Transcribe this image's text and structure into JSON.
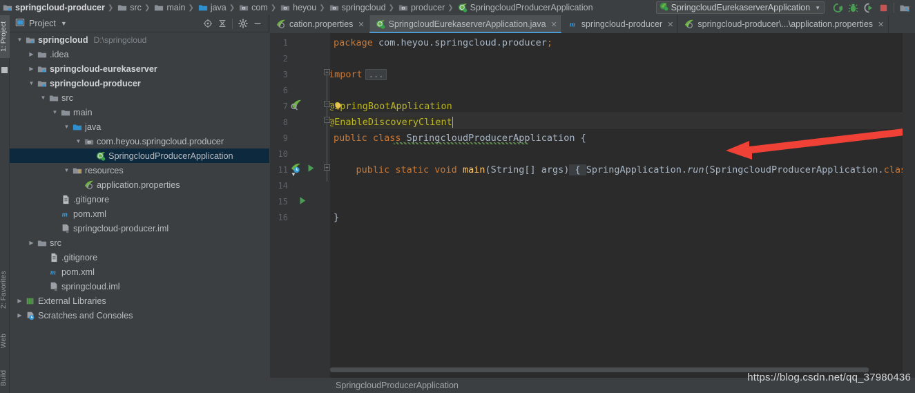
{
  "navbar": {
    "breadcrumbs": [
      {
        "label": "springcloud-producer",
        "icon": "module-icon",
        "bold": true
      },
      {
        "label": "src",
        "icon": "folder-icon",
        "bold": false
      },
      {
        "label": "main",
        "icon": "folder-icon",
        "bold": false
      },
      {
        "label": "java",
        "icon": "source-folder-icon",
        "bold": false
      },
      {
        "label": "com",
        "icon": "package-icon",
        "bold": false
      },
      {
        "label": "heyou",
        "icon": "package-icon",
        "bold": false
      },
      {
        "label": "springcloud",
        "icon": "package-icon",
        "bold": false
      },
      {
        "label": "producer",
        "icon": "package-icon",
        "bold": false
      },
      {
        "label": "SpringcloudProducerApplication",
        "icon": "spring-class-icon",
        "bold": false
      }
    ],
    "run_config": "SpringcloudEurekaserverApplication",
    "actions": [
      "run-icon",
      "debug-icon",
      "run-with-coverage-icon",
      "stop-icon",
      "project-structure-icon"
    ]
  },
  "left_stripe": {
    "tabs": [
      {
        "label": "1: Project",
        "active": true
      },
      {
        "label": "2: Favorites",
        "active": false
      },
      {
        "label": "Web",
        "active": false
      },
      {
        "label": "Build",
        "active": false
      }
    ]
  },
  "project_panel": {
    "title": "Project",
    "actions": [
      "locate-icon",
      "collapse-all-icon",
      "settings-gear-icon",
      "hide-icon"
    ],
    "tree": [
      {
        "label": "springcloud",
        "sub": "D:\\springcloud",
        "depth": 0,
        "arrow": "down",
        "icon": "module-icon",
        "bold": true,
        "selected": false
      },
      {
        "label": ".idea",
        "sub": "",
        "depth": 1,
        "arrow": "right",
        "icon": "folder-icon",
        "bold": false,
        "selected": false
      },
      {
        "label": "springcloud-eurekaserver",
        "sub": "",
        "depth": 1,
        "arrow": "right",
        "icon": "module-icon",
        "bold": true,
        "selected": false
      },
      {
        "label": "springcloud-producer",
        "sub": "",
        "depth": 1,
        "arrow": "down",
        "icon": "module-icon",
        "bold": true,
        "selected": false
      },
      {
        "label": "src",
        "sub": "",
        "depth": 2,
        "arrow": "down",
        "icon": "folder-icon",
        "bold": false,
        "selected": false
      },
      {
        "label": "main",
        "sub": "",
        "depth": 3,
        "arrow": "down",
        "icon": "folder-icon",
        "bold": false,
        "selected": false
      },
      {
        "label": "java",
        "sub": "",
        "depth": 4,
        "arrow": "down",
        "icon": "source-folder-icon",
        "bold": false,
        "selected": false
      },
      {
        "label": "com.heyou.springcloud.producer",
        "sub": "",
        "depth": 5,
        "arrow": "down",
        "icon": "package-icon",
        "bold": false,
        "selected": false
      },
      {
        "label": "SpringcloudProducerApplication",
        "sub": "",
        "depth": 6,
        "arrow": "none",
        "icon": "spring-class-icon",
        "bold": false,
        "selected": true
      },
      {
        "label": "resources",
        "sub": "",
        "depth": 4,
        "arrow": "down",
        "icon": "resources-folder-icon",
        "bold": false,
        "selected": false
      },
      {
        "label": "application.properties",
        "sub": "",
        "depth": 5,
        "arrow": "none",
        "icon": "spring-properties-icon",
        "bold": false,
        "selected": false
      },
      {
        "label": ".gitignore",
        "sub": "",
        "depth": 3,
        "arrow": "none",
        "icon": "file-icon",
        "bold": false,
        "selected": false
      },
      {
        "label": "pom.xml",
        "sub": "",
        "depth": 3,
        "arrow": "none",
        "icon": "maven-icon",
        "bold": false,
        "selected": false
      },
      {
        "label": "springcloud-producer.iml",
        "sub": "",
        "depth": 3,
        "arrow": "none",
        "icon": "iml-icon",
        "bold": false,
        "selected": false
      },
      {
        "label": "src",
        "sub": "",
        "depth": 1,
        "arrow": "right",
        "icon": "folder-icon",
        "bold": false,
        "selected": false
      },
      {
        "label": ".gitignore",
        "sub": "",
        "depth": 2,
        "arrow": "none",
        "icon": "file-icon",
        "bold": false,
        "selected": false
      },
      {
        "label": "pom.xml",
        "sub": "",
        "depth": 2,
        "arrow": "none",
        "icon": "maven-icon",
        "bold": false,
        "selected": false
      },
      {
        "label": "springcloud.iml",
        "sub": "",
        "depth": 2,
        "arrow": "none",
        "icon": "iml-icon",
        "bold": false,
        "selected": false
      },
      {
        "label": "External Libraries",
        "sub": "",
        "depth": 0,
        "arrow": "right",
        "icon": "libraries-icon",
        "bold": false,
        "selected": false
      },
      {
        "label": "Scratches and Consoles",
        "sub": "",
        "depth": 0,
        "arrow": "right",
        "icon": "scratches-icon",
        "bold": false,
        "selected": false
      }
    ]
  },
  "editor_tabs": [
    {
      "label": "cation.properties",
      "icon": "spring-properties-icon",
      "active": false,
      "closable": true
    },
    {
      "label": "SpringcloudEurekaserverApplication.java",
      "icon": "spring-class-icon",
      "active": true,
      "closable": true
    },
    {
      "label": "springcloud-producer",
      "icon": "maven-icon",
      "active": false,
      "closable": true
    },
    {
      "label": "springcloud-producer\\...\\application.properties",
      "icon": "spring-properties-icon",
      "active": false,
      "closable": true
    }
  ],
  "code": {
    "gutter_lines": [
      "1",
      "2",
      "3",
      "6",
      "7",
      "8",
      "9",
      "10",
      "11",
      "14",
      "15",
      "16"
    ],
    "lines": [
      "package com.heyou.springcloud.producer;",
      "",
      "import ...",
      "",
      "@SpringBootApplication",
      "@EnableDiscoveryClient",
      "public class SpringcloudProducerApplication {",
      "",
      "    public static void main(String[] args) { SpringApplication.run(SpringcloudProducerApplication.class,",
      "",
      "}",
      ""
    ],
    "annotation_arrow_color": "#ef4136"
  },
  "status_bar": {
    "text": "SpringcloudProducerApplication"
  },
  "watermark": "https://blog.csdn.net/qq_37980436"
}
